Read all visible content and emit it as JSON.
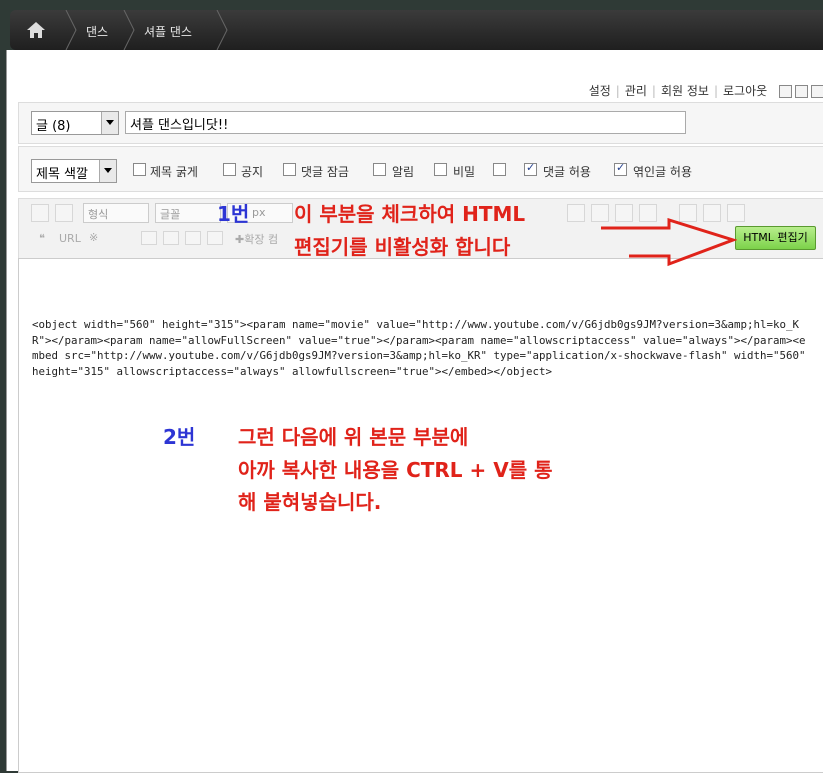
{
  "breadcrumb": {
    "items": [
      "댄스",
      "셔플 댄스"
    ]
  },
  "top_links": [
    "설정",
    "관리",
    "회원 정보",
    "로그아웃"
  ],
  "title_row": {
    "category": "글 (8)",
    "title": "셔플 댄스입니닷!!"
  },
  "options": {
    "color_select": "제목 색깔",
    "checkboxes": [
      {
        "label": "제목 굵게",
        "checked": false
      },
      {
        "label": "공지",
        "checked": false
      },
      {
        "label": "댓글 잠금",
        "checked": false
      },
      {
        "label": "알림",
        "checked": false
      },
      {
        "label": "비밀",
        "checked": false
      },
      {
        "label": "",
        "checked": false
      },
      {
        "label": "댓글 허용",
        "checked": true
      },
      {
        "label": "엮인글 허용",
        "checked": true
      }
    ]
  },
  "toolbar": {
    "format_select": "형식",
    "font_select": "글꼴",
    "size_select": "px",
    "link_label": "URL",
    "extend_label": "확장 컴",
    "html_editor_button": "HTML 편집기"
  },
  "editor": {
    "content": "<object width=\"560\" height=\"315\"><param name=\"movie\" value=\"http://www.youtube.com/v/G6jdb0gs9JM?version=3&amp;hl=ko_KR\"></param><param name=\"allowFullScreen\" value=\"true\"></param><param name=\"allowscriptaccess\" value=\"always\"></param><embed src=\"http://www.youtube.com/v/G6jdb0gs9JM?version=3&amp;hl=ko_KR\" type=\"application/x-shockwave-flash\" width=\"560\" height=\"315\" allowscriptaccess=\"always\" allowfullscreen=\"true\"></embed></object>"
  },
  "annotations": {
    "step1_number": "1번",
    "step1_line1": "이 부분을 체크하여 HTML",
    "step1_line2": "편집기를 비활성화 합니다",
    "step2_number": "2번",
    "step2_line1": "그런 다음에 위 본문 부분에",
    "step2_line2": "아까 복사한 내용을 CTRL + V를 통",
    "step2_line3": "해 붙혀넣습니다.",
    "colors": {
      "red": "#e0231a",
      "blue": "#2d35d4"
    }
  }
}
